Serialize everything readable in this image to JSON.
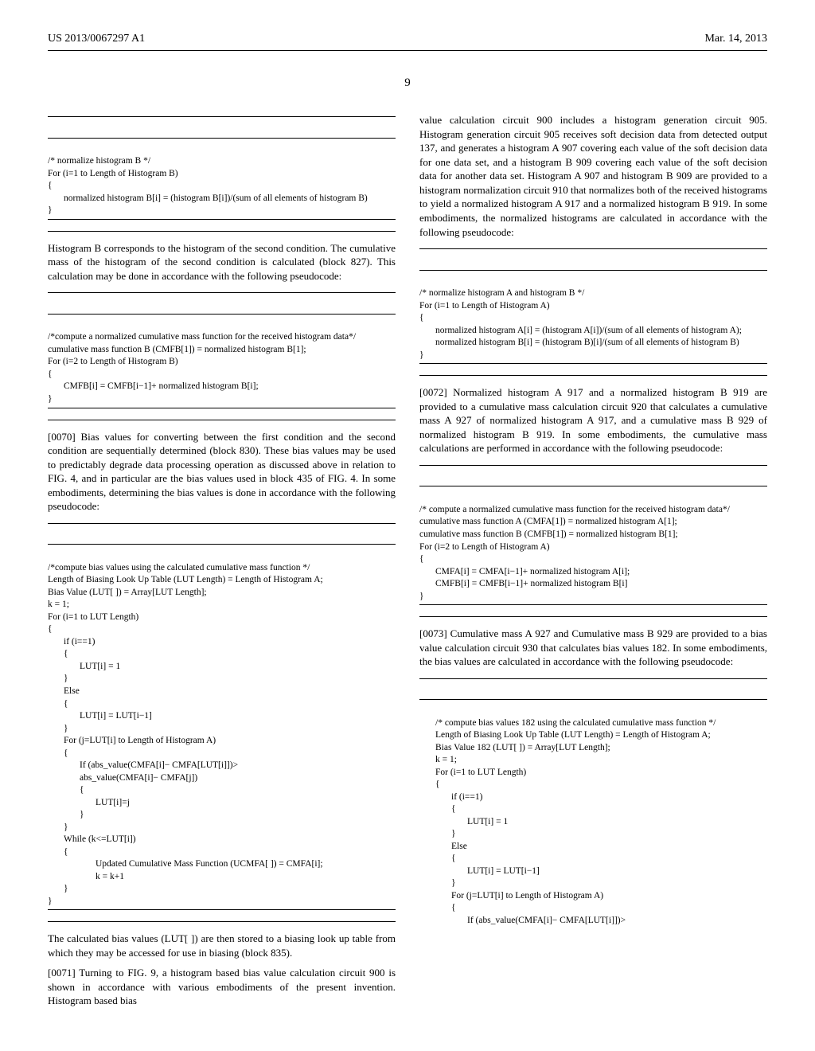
{
  "header": {
    "left": "US 2013/0067297 A1",
    "right": "Mar. 14, 2013"
  },
  "page_number": "9",
  "left_col": {
    "code1": {
      "c1": "/* normalize histogram B */",
      "c2": "For (i=1 to Length of Histogram B)",
      "c3": "{",
      "c4": "normalized histogram B[i] = (histogram B[i])/(sum of all elements of histogram B)",
      "c5": "}"
    },
    "para1": "Histogram B corresponds to the histogram of the second condition. The cumulative mass of the histogram of the second condition is calculated (block 827). This calculation may be done in accordance with the following pseudocode:",
    "code2": {
      "c1": "/*compute a normalized cumulative mass function for the received histogram data*/",
      "c2": "cumulative mass function B (CMFB[1]) = normalized histogram B[1];",
      "c3": "For (i=2 to Length of Histogram B)",
      "c4": "{",
      "c5": "CMFB[i] = CMFB[i−1]+ normalized histogram B[i];",
      "c6": "}"
    },
    "para2_num": "[0070]",
    "para2": "   Bias values for converting between the first condition and the second condition are sequentially determined (block 830). These bias values may be used to predictably degrade data processing operation as discussed above in relation to FIG. 4, and in particular are the bias values used in block 435 of FIG. 4. In some embodiments, determining the bias values is done in accordance with the following pseudocode:",
    "code3": {
      "c1": "/*compute bias values using the calculated cumulative mass function */",
      "c2": "Length of Biasing Look Up Table (LUT Length) = Length of Histogram A;",
      "c3": "Bias Value (LUT[ ]) = Array[LUT Length];",
      "c4": "k = 1;",
      "c5": "For (i=1 to LUT Length)",
      "c6": "{",
      "c7": "if (i==1)",
      "c8": "{",
      "c9": "LUT[i] = 1",
      "c10": "}",
      "c11": "Else",
      "c12": "{",
      "c13": "LUT[i] = LUT[i−1]",
      "c14": "}",
      "c15": "For (j=LUT[i] to Length of Histogram A)",
      "c16": "{",
      "c17": "If (abs_value(CMFA[i]− CMFA[LUT[i]])>",
      "c18": "abs_value(CMFA[i]− CMFA[j])",
      "c19": "{",
      "c20": "LUT[i]=j",
      "c21": "}",
      "c22": "}",
      "c23": "While (k<=LUT[i])",
      "c24": "{",
      "c25": "Updated Cumulative Mass Function (UCMFA[ ]) = CMFA[i];",
      "c26": "k = k+1",
      "c27": "}",
      "c28": "}"
    },
    "para3": "The calculated bias values (LUT[ ]) are then stored to a biasing look up table from which they may be accessed for use in biasing (block 835).",
    "para4_num": "[0071]",
    "para4": "   Turning to FIG. 9, a histogram based bias value calculation circuit 900 is shown in accordance with various embodiments of the present invention. Histogram based bias"
  },
  "right_col": {
    "para1": "value calculation circuit 900 includes a histogram generation circuit 905. Histogram generation circuit 905 receives soft decision data from detected output 137, and generates a histogram A 907 covering each value of the soft decision data for one data set, and a histogram B 909 covering each value of the soft decision data for another data set. Histogram A 907 and histogram B 909 are provided to a histogram normalization circuit 910 that normalizes both of the received histograms to yield a normalized histogram A 917 and a normalized histogram B 919. In some embodiments, the normalized histograms are calculated in accordance with the following pseudocode:",
    "code1": {
      "c1": "/* normalize histogram A and histogram B */",
      "c2": "For (i=1 to Length of Histogram A)",
      "c3": "{",
      "c4": "normalized histogram A[i] = (histogram A[i])/(sum of all elements of histogram A);",
      "c5": "normalized histogram B[i] = (histogram B)[i]/(sum of all elements of histogram B)",
      "c6": "}"
    },
    "para2_num": "[0072]",
    "para2": "   Normalized histogram A 917 and a normalized histogram B 919 are provided to a cumulative mass calculation circuit 920 that calculates a cumulative mass A 927 of normalized histogram A 917, and a cumulative mass B 929 of normalized histogram B 919. In some embodiments, the cumulative mass calculations are performed in accordance with the following pseudocode:",
    "code2": {
      "c1": "/* compute a normalized cumulative mass function for the received histogram data*/",
      "c2": "cumulative mass function A (CMFA[1]) = normalized histogram A[1];",
      "c3": "cumulative mass function B (CMFB[1]) = normalized histogram B[1];",
      "c4": "For (i=2 to Length of Histogram A)",
      "c5": "{",
      "c6": "CMFA[i] = CMFA[i−1]+ normalized histogram A[i];",
      "c7": "CMFB[i] = CMFB[i−1]+ normalized histogram B[i]",
      "c8": "}"
    },
    "para3_num": "[0073]",
    "para3": "   Cumulative mass A 927 and Cumulative mass B 929 are provided to a bias value calculation circuit 930 that calculates bias values 182. In some embodiments, the bias values are calculated in accordance with the following pseudocode:",
    "code3": {
      "c1": "/* compute bias values 182 using the calculated cumulative mass function */",
      "c2": "Length of Biasing Look Up Table (LUT Length) = Length of Histogram A;",
      "c3": "Bias Value 182 (LUT[ ]) = Array[LUT Length];",
      "c4": "k = 1;",
      "c5": "For (i=1 to LUT Length)",
      "c6": "{",
      "c7": "if (i==1)",
      "c8": "{",
      "c9": "LUT[i] = 1",
      "c10": "}",
      "c11": "Else",
      "c12": "{",
      "c13": "LUT[i] = LUT[i−1]",
      "c14": "}",
      "c15": "For (j=LUT[i] to Length of Histogram A)",
      "c16": "{",
      "c17": "If (abs_value(CMFA[i]− CMFA[LUT[i]])>"
    }
  }
}
